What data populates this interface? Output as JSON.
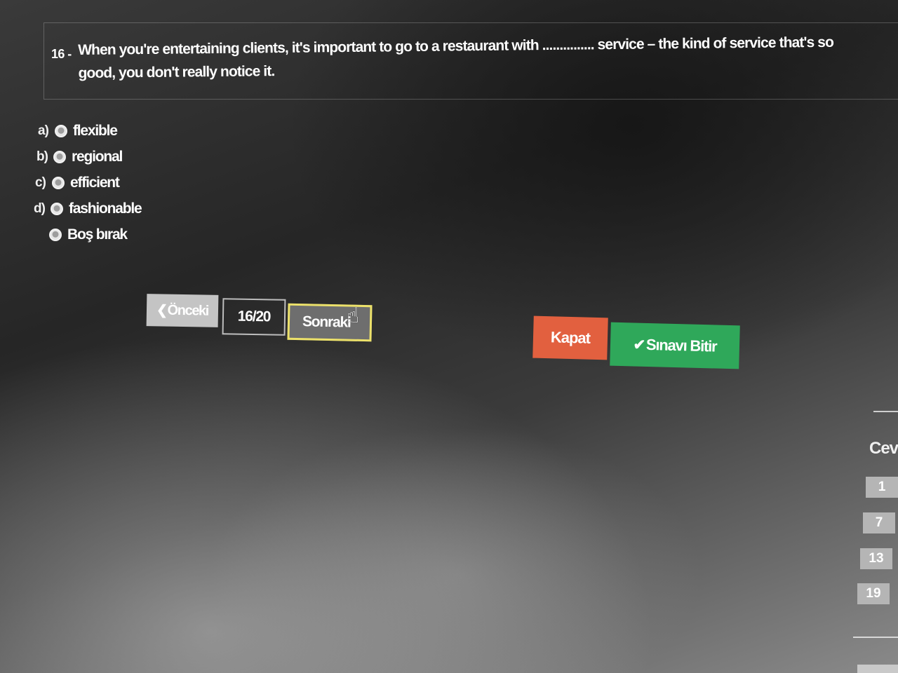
{
  "question": {
    "number": "16 -",
    "text": "When you're entertaining clients, it's important to go to a restaurant with ............... service – the kind of service that's so good, you don't really notice it."
  },
  "options": [
    {
      "letter": "a)",
      "label": "flexible"
    },
    {
      "letter": "b)",
      "label": "regional"
    },
    {
      "letter": "c)",
      "label": "efficient"
    },
    {
      "letter": "d)",
      "label": "fashionable"
    },
    {
      "letter": "",
      "label": "Boş bırak"
    }
  ],
  "navigation": {
    "prev_label": "Önceki",
    "prev_icon": "chevron-left-icon",
    "counter": "16/20",
    "next_label": "Sonraki",
    "cursor_icon": "hand-pointer-icon"
  },
  "actions": {
    "close_label": "Kapat",
    "close_color": "#e2603f",
    "finish_label": "Sınavı Bitir",
    "finish_icon": "check-icon",
    "finish_color": "#2fa85a"
  },
  "answer_panel": {
    "title": "Cev",
    "cells": [
      "1",
      "7",
      "13",
      "19"
    ]
  }
}
